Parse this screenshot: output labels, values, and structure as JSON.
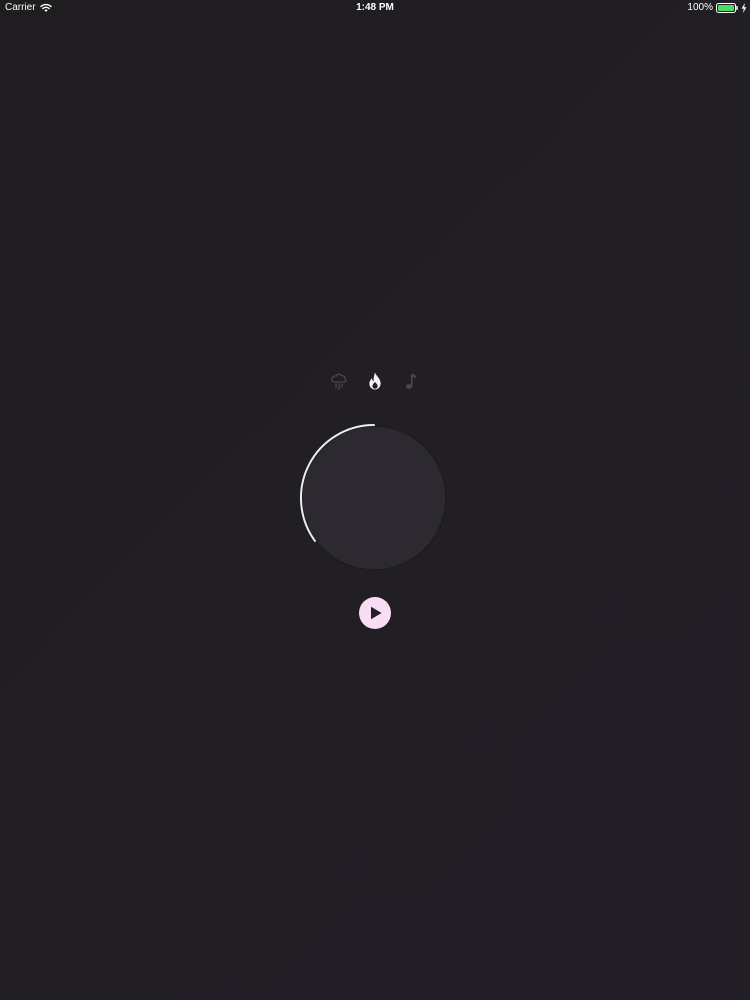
{
  "status_bar": {
    "carrier": "Carrier",
    "time": "1:48 PM",
    "battery_percent": "100%",
    "battery_level": 1.0
  },
  "sound_selector": {
    "options": [
      {
        "icon": "rain-cloud-icon",
        "selected": false
      },
      {
        "icon": "flame-icon",
        "selected": true
      },
      {
        "icon": "music-note-icon",
        "selected": false
      }
    ]
  },
  "timer": {
    "progress_fraction": 0.35
  },
  "colors": {
    "background": "#221f24",
    "dial_fill": "#2c2a30",
    "dial_ring": "#1d1b1f",
    "arc": "#ededed",
    "icon_selected": "#f6f0f6",
    "icon_inactive": "#4a474c",
    "play_fill": "#f9dcf6",
    "play_icon": "#232025",
    "battery": "#4cd964"
  },
  "controls": {
    "play_icon": "play-icon"
  }
}
